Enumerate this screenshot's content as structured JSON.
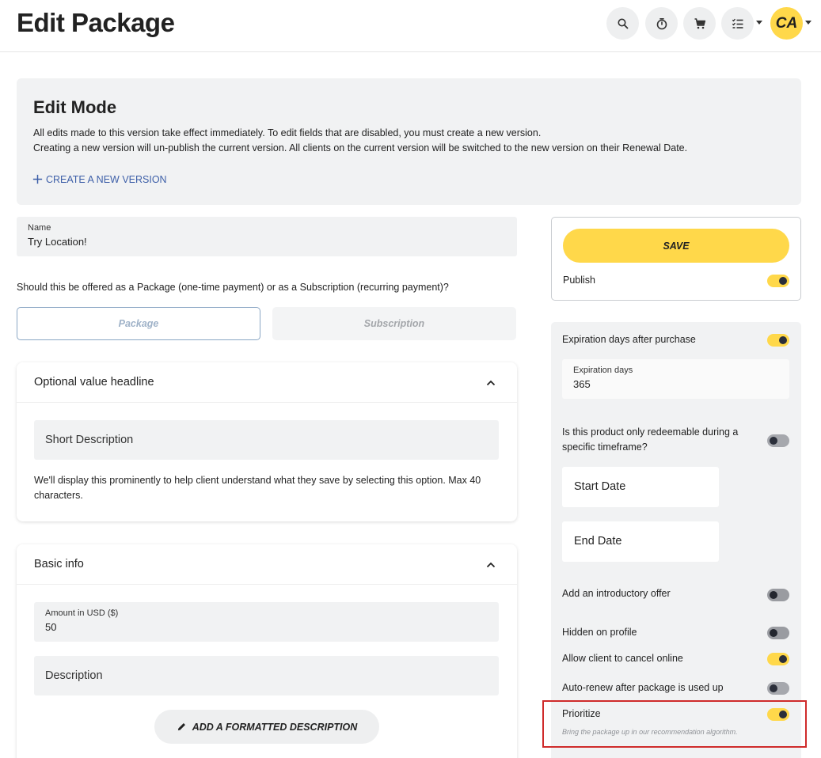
{
  "header": {
    "title": "Edit Package",
    "avatar_initials": "CA",
    "icons": [
      "search-icon",
      "timer-icon",
      "cart-icon",
      "checklist-icon"
    ]
  },
  "edit_mode": {
    "title": "Edit Mode",
    "line1": "All edits made to this version take effect immediately. To edit fields that are disabled, you must create a new version.",
    "line2": "Creating a new version will un-publish the current version. All clients on the current version will be switched to the new version on their Renewal Date.",
    "create_link": "CREATE A NEW VERSION"
  },
  "name_field": {
    "label": "Name",
    "value": "Try Location!"
  },
  "offer_type": {
    "question": "Should this be offered as a Package (one-time payment) or as a Subscription (recurring payment)?",
    "package_label": "Package",
    "subscription_label": "Subscription",
    "selected": "Package"
  },
  "value_headline": {
    "title": "Optional value headline",
    "short_description_placeholder": "Short Description",
    "help": "We'll display this prominently to help client understand what they save by selecting this option. Max 40 characters."
  },
  "basic_info": {
    "title": "Basic info",
    "amount_label": "Amount in USD ($)",
    "amount_value": "50",
    "description_placeholder": "Description",
    "formatted_button": "ADD A FORMATTED DESCRIPTION"
  },
  "save_panel": {
    "save_label": "SAVE",
    "publish_label": "Publish",
    "publish_on": true
  },
  "settings": {
    "expiration_label": "Expiration days after purchase",
    "expiration_on": true,
    "expiration_days_label": "Expiration days",
    "expiration_days_value": "365",
    "timeframe_label_line1": "Is this product only redeemable during a",
    "timeframe_label_line2": "specific timeframe?",
    "timeframe_on": false,
    "start_date": "Start Date",
    "end_date": "End Date",
    "intro_offer_label": "Add an introductory offer",
    "intro_offer_on": false,
    "hidden_label": "Hidden on profile",
    "hidden_on": false,
    "cancel_label": "Allow client to cancel online",
    "cancel_on": true,
    "autorenew_label": "Auto-renew after package is used up",
    "autorenew_on": false,
    "prioritize_label": "Prioritize",
    "prioritize_on": true,
    "prioritize_help": "Bring the package up in our recommendation algorithm."
  },
  "colors": {
    "accent": "#ffd84a",
    "link": "#3d5fa8",
    "highlight": "#cf2b2b",
    "panel": "#f1f2f3"
  }
}
